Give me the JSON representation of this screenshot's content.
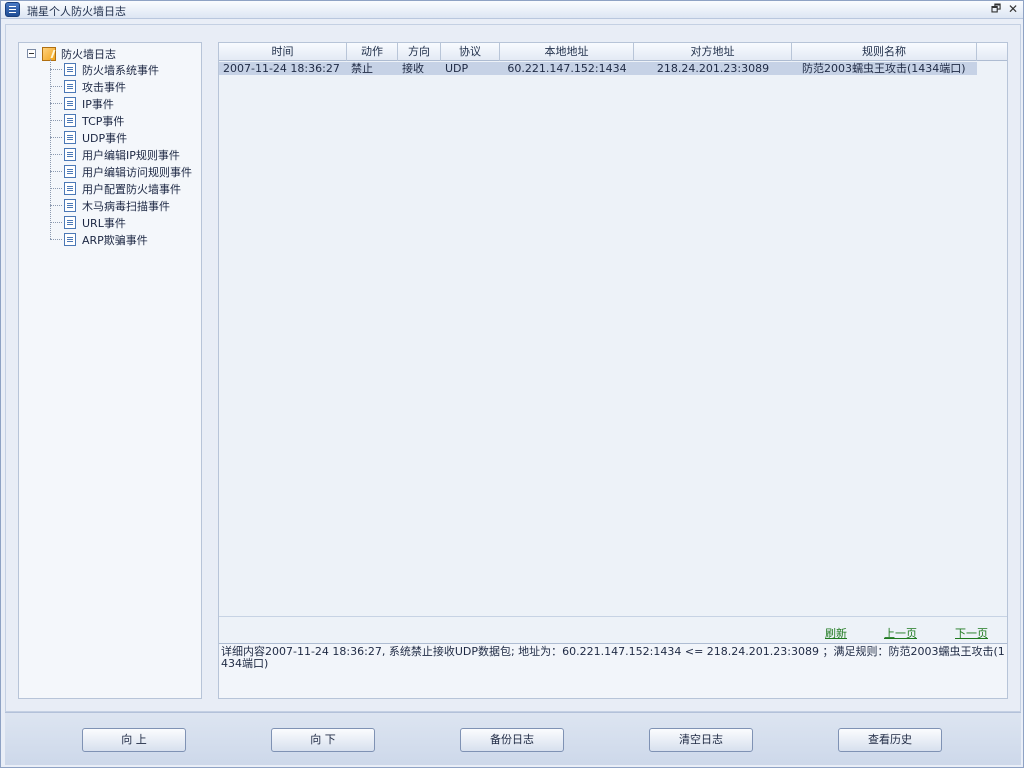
{
  "window": {
    "title": "瑞星个人防火墙日志"
  },
  "tree": {
    "root": "防火墙日志",
    "items": [
      "防火墙系统事件",
      "攻击事件",
      "IP事件",
      "TCP事件",
      "UDP事件",
      "用户编辑IP规则事件",
      "用户编辑访问规则事件",
      "用户配置防火墙事件",
      "木马病毒扫描事件",
      "URL事件",
      "ARP欺骗事件"
    ]
  },
  "table": {
    "columns": [
      "时间",
      "动作",
      "方向",
      "协议",
      "本地地址",
      "对方地址",
      "规则名称"
    ],
    "rows": [
      {
        "time": "2007-11-24 18:36:27",
        "action": "禁止",
        "direction": "接收",
        "protocol": "UDP",
        "local": "60.221.147.152:1434",
        "remote": "218.24.201.23:3089",
        "rule": "防范2003蠕虫王攻击(1434端口)"
      }
    ]
  },
  "nav": {
    "refresh": "刷新",
    "prev": "上一页",
    "next": "下一页"
  },
  "detail": "详细内容2007-11-24 18:36:27, 系统禁止接收UDP数据包; 地址为：60.221.147.152:1434 <= 218.24.201.23:3089 ；满足规则：防范2003蠕虫王攻击(1434端口)",
  "buttons": {
    "up": "向 上",
    "down": "向 下",
    "backup": "备份日志",
    "clear": "清空日志",
    "history": "查看历史"
  },
  "icons": {
    "app": "firewall-app-icon",
    "root": "folder-log-icon",
    "item": "log-document-icon",
    "restore": "restore-icon",
    "close": "close-icon"
  }
}
